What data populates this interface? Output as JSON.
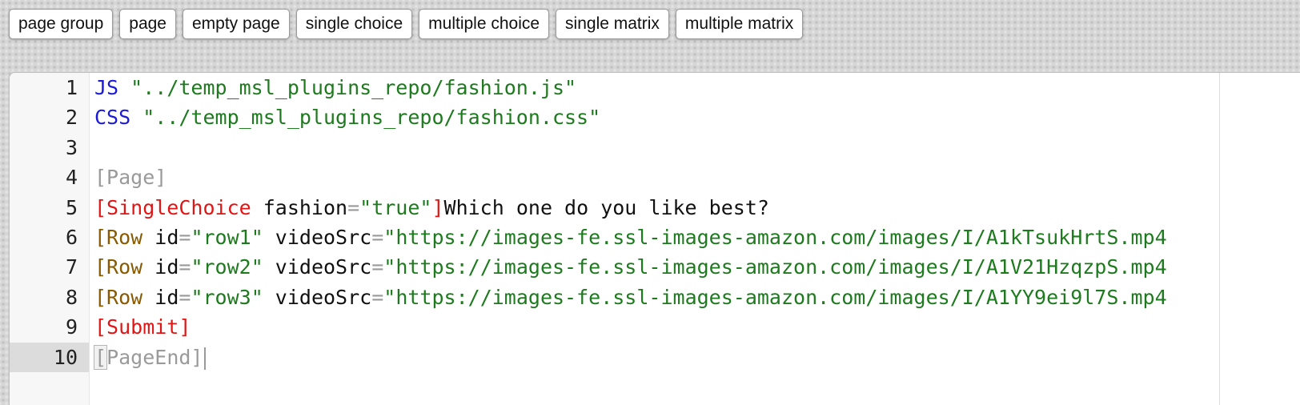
{
  "toolbar": {
    "buttons": [
      {
        "label": "page group"
      },
      {
        "label": "page"
      },
      {
        "label": "empty page"
      },
      {
        "label": "single choice"
      },
      {
        "label": "multiple choice"
      },
      {
        "label": "single matrix"
      },
      {
        "label": "multiple matrix"
      }
    ]
  },
  "editor": {
    "line_numbers": [
      "1",
      "2",
      "3",
      "4",
      "5",
      "6",
      "7",
      "8",
      "9",
      "10"
    ],
    "active_line": "10",
    "lines": {
      "l1": {
        "kw": "JS",
        "str": " \"../temp_msl_plugins_repo/fashion.js\""
      },
      "l2": {
        "kw": "CSS",
        "str": " \"../temp_msl_plugins_repo/fashion.css\""
      },
      "l4": {
        "meta": "[Page]"
      },
      "l5": {
        "open": "[SingleChoice",
        "attr": " fashion",
        "eq": "=",
        "val": "\"true\"",
        "close": "]",
        "text": "Which one do you like best?"
      },
      "l6": {
        "open": "[Row",
        "a1": " id",
        "eq1": "=",
        "v1": "\"row1\"",
        "a2": " videoSrc",
        "eq2": "=",
        "v2": "\"https://images-fe.ssl-images-amazon.com/images/I/A1kTsukHrtS.mp4"
      },
      "l7": {
        "open": "[Row",
        "a1": " id",
        "eq1": "=",
        "v1": "\"row2\"",
        "a2": " videoSrc",
        "eq2": "=",
        "v2": "\"https://images-fe.ssl-images-amazon.com/images/I/A1V21HzqzpS.mp4"
      },
      "l8": {
        "open": "[Row",
        "a1": " id",
        "eq1": "=",
        "v1": "\"row3\"",
        "a2": " videoSrc",
        "eq2": "=",
        "v2": "\"https://images-fe.ssl-images-amazon.com/images/I/A1YY9ei9l7S.mp4"
      },
      "l9": {
        "tag": "[Submit]"
      },
      "l10": {
        "open": "[",
        "rest": "PageEnd]"
      }
    }
  },
  "colors": {
    "keyword": "#1a1ad8",
    "string": "#1e7a1e",
    "tag": "#e01515",
    "row_tag": "#8a5a00",
    "meta": "#9a9a9a"
  }
}
